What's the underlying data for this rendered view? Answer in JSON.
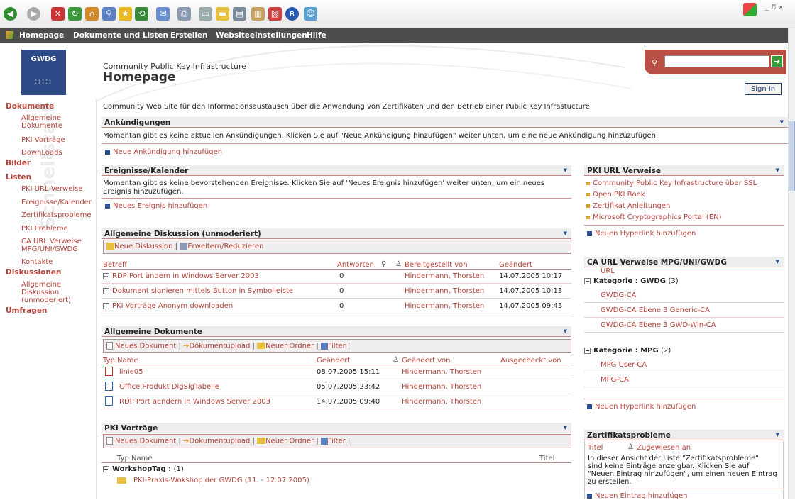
{
  "nav": {
    "home": "Homepage",
    "docs": "Dokumente und Listen",
    "create": "Erstellen",
    "settings": "Websiteeinstellungen",
    "help": "Hilfe"
  },
  "window": {
    "controls": "_ ♬ ×"
  },
  "site": {
    "logo": "GWDG",
    "name": "Community Public Key Infrastructure",
    "title": "Homepage",
    "sign_in": "Sign In",
    "description": "Community Web Site für den Informationsaustausch über die Anwendung von Zertifikaten und den Betrieb einer Public Key Infrastucture"
  },
  "quicklaunch": {
    "watermark": "Schnellstart",
    "dokumente": "Dokumente",
    "d1a": "Allgemeine",
    "d1b": "Dokumente",
    "d2": "PKI Vorträge",
    "d3": "DownLoads",
    "bilder": "Bilder",
    "listen": "Listen",
    "l1": "PKI URL Verweise",
    "l2": "Ereignisse/Kalender",
    "l3": "Zertifikatsprobleme",
    "l4": "PKI Probleme",
    "l5a": "CA URL Verweise",
    "l5b": "MPG/UNI/GWDG",
    "l6": "Kontakte",
    "diskussionen": "Diskussionen",
    "k1a": "Allgemeine",
    "k1b": "Diskussion",
    "k1c": "(unmoderiert)",
    "umfragen": "Umfragen"
  },
  "announce": {
    "title": "Ankündigungen",
    "empty": "Momentan gibt es keine aktuellen Ankündigungen. Klicken Sie auf \"Neue Ankündigung hinzufügen\" weiter unten, um eine neue Ankündigung hinzuzufügen.",
    "add": "Neue Ankündigung hinzufügen"
  },
  "events": {
    "title": "Ereignisse/Kalender",
    "empty1": "Momentan gibt es keine bevorstehenden Ereignisse. Klicken Sie auf 'Neues Ereignis hinzufügen' weiter unten, um ein neues",
    "empty2": "Ereignis hinzuzufügen.",
    "add": "Neues Ereignis hinzufügen"
  },
  "discussion": {
    "title": "Allgemeine Diskussion (unmoderiert)",
    "new": "Neue Diskussion",
    "expand": "Erweitern/Reduzieren",
    "cols": {
      "subject": "Betreff",
      "replies": "Antworten",
      "by": "Bereitgestellt von",
      "changed": "Geändert"
    },
    "rows": [
      {
        "subject": "RDP Port ändern in Windows Server 2003",
        "replies": "0",
        "by": "Hindermann, Thorsten",
        "changed": "14.07.2005 10:17"
      },
      {
        "subject": "Dokument signieren mittels Button in Symbolleiste",
        "replies": "0",
        "by": "Hindermann, Thorsten",
        "changed": "14.07.2005 10:13"
      },
      {
        "subject": "PKI Vorträge Anonym downloaden",
        "replies": "0",
        "by": "Hindermann, Thorsten",
        "changed": "14.07.2005 09:43"
      }
    ]
  },
  "documents": {
    "title": "Allgemeine Dokumente",
    "new": "Neues Dokument",
    "upload": "Dokumentupload",
    "folder": "Neuer Ordner",
    "filter": "Filter",
    "cols": {
      "typename": "Typ Name",
      "changed": "Geändert",
      "changed_by": "Geändert von",
      "checked_out": "Ausgecheckt von"
    },
    "rows": [
      {
        "name": "linie05",
        "changed": "08.07.2005 15:11",
        "by": "Hindermann, Thorsten"
      },
      {
        "name": "Office Produkt DigSigTabelle",
        "changed": "05.07.2005 23:42",
        "by": "Hindermann, Thorsten"
      },
      {
        "name": "RDP Port aendern in Windows Server 2003",
        "changed": "14.07.2005 09:40",
        "by": "Hindermann, Thorsten"
      }
    ]
  },
  "pki": {
    "title": "PKI Vorträge",
    "new": "Neues Dokument",
    "upload": "Dokumentupload",
    "folder": "Neuer Ordner",
    "filter": "Filter",
    "cols": {
      "typename": "Typ Name",
      "titel": "Titel"
    },
    "group": "WorkshopTag :",
    "group_count": "(1)",
    "item": "PKI-Praxis-Wokshop der GWDG (11. - 12.07.2005)"
  },
  "pkiurl": {
    "title": "PKI URL Verweise",
    "links": [
      "Community Public Key Infrastructure über SSL",
      "Open PKI Book",
      "Zertifikat Anleitungen",
      "Microsoft Cryptographics Portal (EN)"
    ],
    "add": "Neuen Hyperlink hinzufügen"
  },
  "caurl": {
    "title": "CA URL Verweise MPG/UNI/GWDG",
    "url": "URL",
    "cat1": "Kategorie : GWDG",
    "cat1_count": "(3)",
    "cat1_items": [
      "GWDG-CA",
      "GWDG-CA Ebene 3 Generic-CA",
      "GWDG-CA Ebene 3 GWD-Win-CA"
    ],
    "cat2": "Kategorie : MPG",
    "cat2_count": "(2)",
    "cat2_items": [
      "MPG User-CA",
      "MPG-CA"
    ],
    "add": "Neuen Hyperlink hinzufügen"
  },
  "zert": {
    "title": "Zertifikatsprobleme",
    "col_title": "Titel",
    "col_assigned": "Zugewiesen an",
    "empty1": "In dieser Ansicht der Liste \"Zertifikatsprobleme\"",
    "empty2": "sind keine Einträge anzeigbar. Klicken Sie auf",
    "empty3": "\"Neuen Eintrag hinzufügen\", um einen neuen Eintrag",
    "empty4": "zu erstellen.",
    "add": "Neuen Eintrag hinzufügen"
  }
}
